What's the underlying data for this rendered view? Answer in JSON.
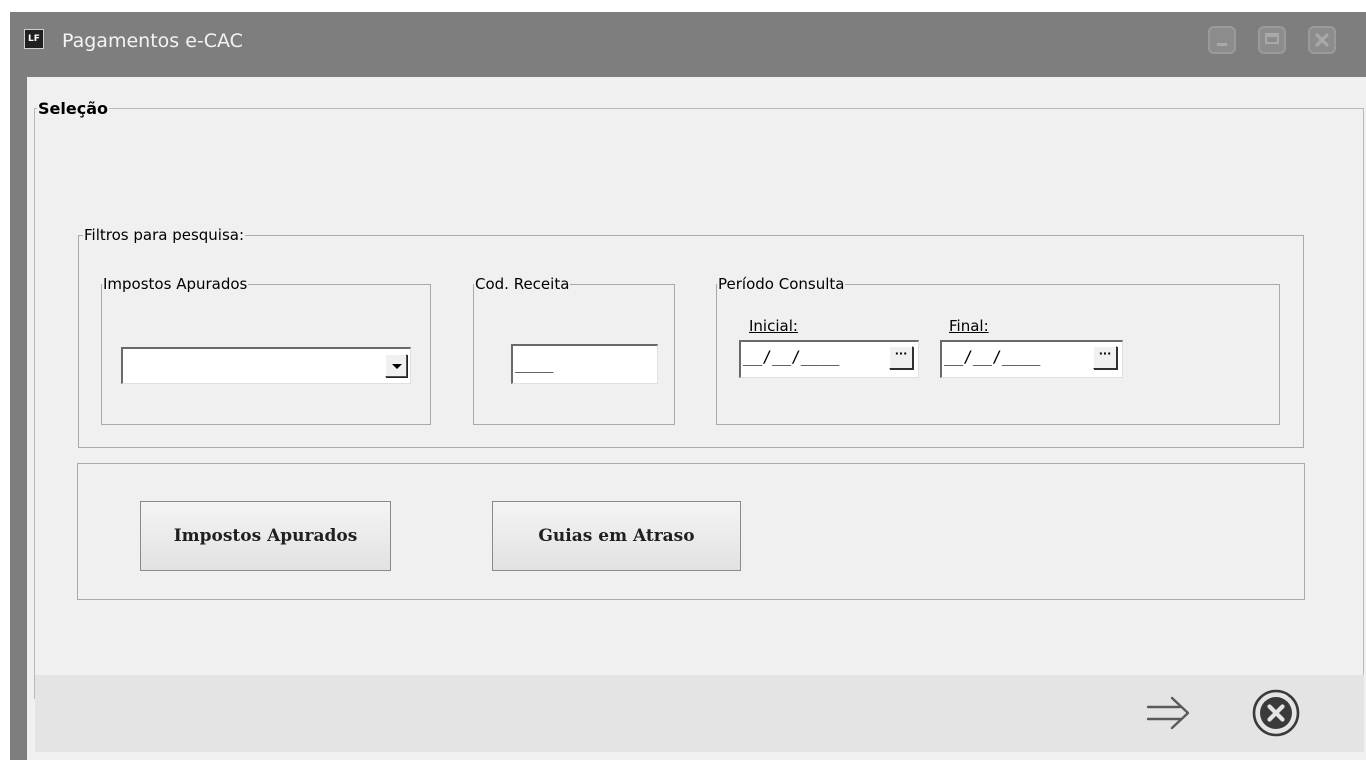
{
  "window": {
    "title": "Pagamentos e-CAC",
    "icon": "app-logo-icon",
    "icon_text": "LF",
    "controls": [
      "minimize-icon",
      "maximize-icon",
      "close-icon"
    ]
  },
  "selecao": {
    "legend": "Seleção",
    "filtros": {
      "legend": "Filtros para pesquisa:",
      "impostos_apurados": {
        "legend": "Impostos Apurados",
        "selected_value": ""
      },
      "cod_receita": {
        "legend": "Cod. Receita",
        "value": "____"
      },
      "periodo_consulta": {
        "legend": "Período Consulta",
        "inicial_label": "Inicial:",
        "inicial_value": "__/__/____",
        "final_label": "Final:",
        "final_value": "__/__/____",
        "picker_glyph": "···"
      }
    },
    "buttons": {
      "impostos_apurados": "Impostos Apurados",
      "guias_em_atraso": "Guias em Atraso"
    }
  },
  "footer": {
    "next_icon": "arrow-right-icon",
    "close_icon": "close-circle-icon"
  }
}
